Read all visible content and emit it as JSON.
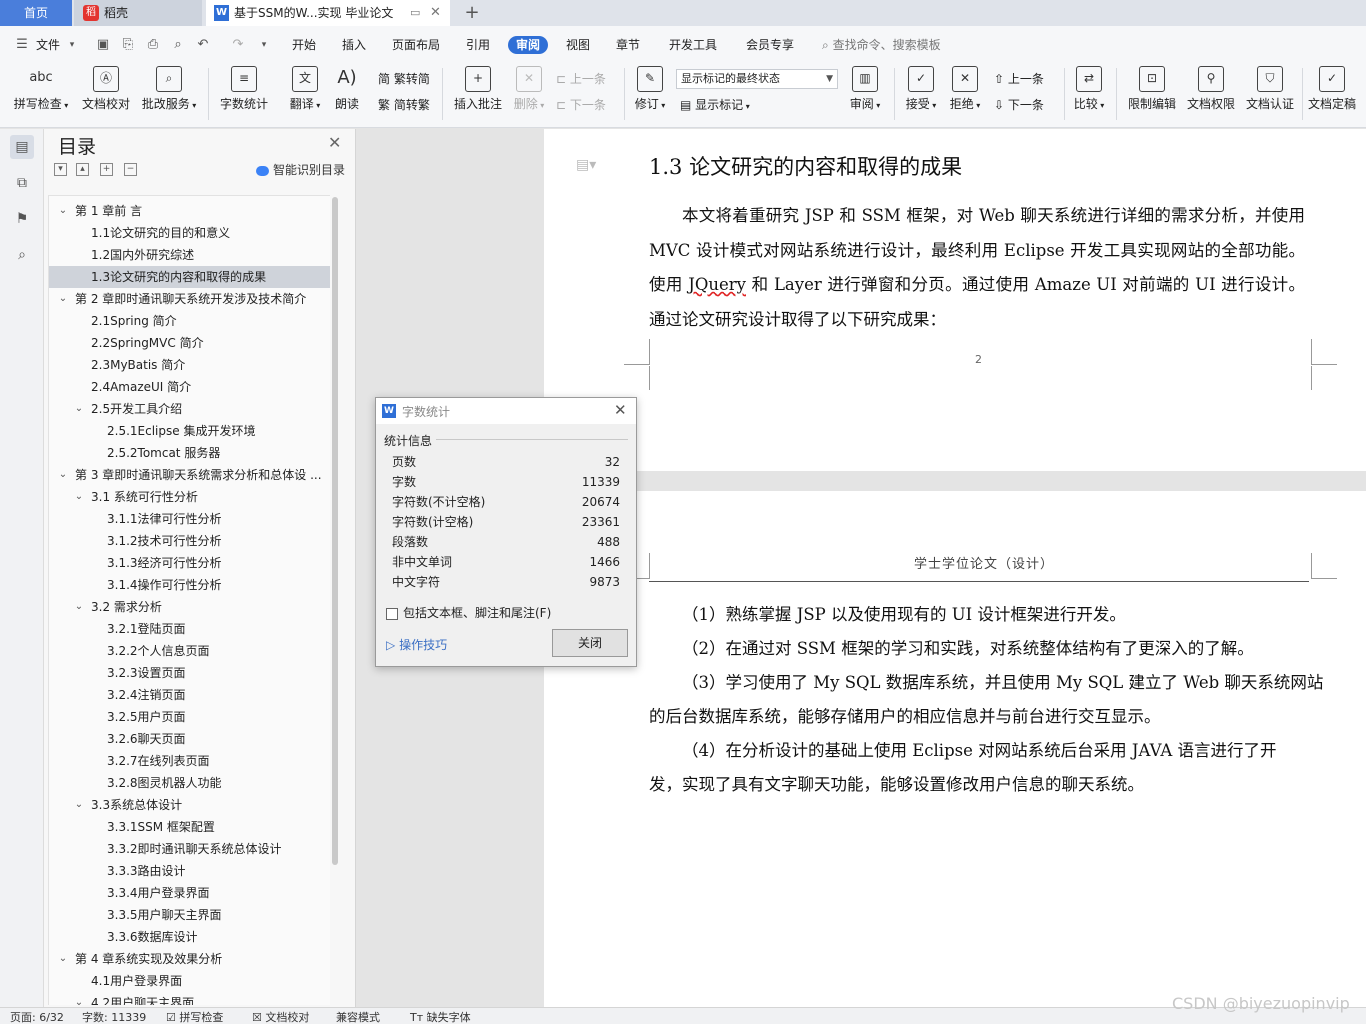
{
  "tabs": {
    "home": "首页",
    "dao": "稻壳",
    "doc": "基于SSM的W...实现 毕业论文",
    "add": "+"
  },
  "menu": {
    "file": "文件",
    "items": [
      "开始",
      "插入",
      "页面布局",
      "引用",
      "审阅",
      "视图",
      "章节",
      "开发工具",
      "会员专享"
    ],
    "active_index": 4,
    "search": "查找命令、搜索模板"
  },
  "ribbon": {
    "spell": "拼写检查",
    "proof": "文档校对",
    "batch": "批改服务",
    "wordcount": "字数统计",
    "translate": "翻译",
    "read": "朗读",
    "trad": "繁转简",
    "simp": "简转繁",
    "insert_comment": "插入批注",
    "delete": "删除",
    "prev_comment": "上一条",
    "next_comment": "下一条",
    "track": "修订",
    "markup_state": "显示标记的最终状态",
    "show_markup": "显示标记",
    "review": "审阅",
    "accept": "接受",
    "reject": "拒绝",
    "prev": "上一条",
    "next": "下一条",
    "compare": "比较",
    "restrict": "限制编辑",
    "permission": "文档权限",
    "certify": "文档认证",
    "finalize": "文档定稿"
  },
  "toc": {
    "title": "目录",
    "smart": "智能识别目录",
    "items": [
      {
        "text": "第 1 章前  言",
        "level": 0,
        "expand": true
      },
      {
        "text": "1.1论文研究的目的和意义",
        "level": 1
      },
      {
        "text": "1.2国内外研究综述",
        "level": 1
      },
      {
        "text": "1.3论文研究的内容和取得的成果",
        "level": 1,
        "selected": true
      },
      {
        "text": "第 2 章即时通讯聊天系统开发涉及技术简介",
        "level": 0,
        "expand": true
      },
      {
        "text": "2.1Spring 简介",
        "level": 1
      },
      {
        "text": "2.2SpringMVC 简介",
        "level": 1
      },
      {
        "text": "2.3MyBatis 简介",
        "level": 1
      },
      {
        "text": "2.4AmazeUI 简介",
        "level": 1
      },
      {
        "text": "2.5开发工具介绍",
        "level": 1,
        "expand": true
      },
      {
        "text": "2.5.1Eclipse 集成开发环境",
        "level": 2
      },
      {
        "text": "2.5.2Tomcat 服务器",
        "level": 2
      },
      {
        "text": "第 3 章即时通讯聊天系统需求分析和总体设 ...",
        "level": 0,
        "expand": true
      },
      {
        "text": "3.1  系统可行性分析",
        "level": 1,
        "expand": true
      },
      {
        "text": "3.1.1法律可行性分析",
        "level": 2
      },
      {
        "text": "3.1.2技术可行性分析",
        "level": 2
      },
      {
        "text": "3.1.3经济可行性分析",
        "level": 2
      },
      {
        "text": "3.1.4操作可行性分析",
        "level": 2
      },
      {
        "text": "3.2  需求分析",
        "level": 1,
        "expand": true
      },
      {
        "text": "3.2.1登陆页面",
        "level": 2
      },
      {
        "text": "3.2.2个人信息页面",
        "level": 2
      },
      {
        "text": "3.2.3设置页面",
        "level": 2
      },
      {
        "text": "3.2.4注销页面",
        "level": 2
      },
      {
        "text": "3.2.5用户页面",
        "level": 2
      },
      {
        "text": "3.2.6聊天页面",
        "level": 2
      },
      {
        "text": "3.2.7在线列表页面",
        "level": 2
      },
      {
        "text": "3.2.8图灵机器人功能",
        "level": 2
      },
      {
        "text": "3.3系统总体设计",
        "level": 1,
        "expand": true
      },
      {
        "text": "3.3.1SSM 框架配置",
        "level": 2
      },
      {
        "text": "3.3.2即时通讯聊天系统总体设计",
        "level": 2
      },
      {
        "text": "3.3.3路由设计",
        "level": 2
      },
      {
        "text": "3.3.4用户登录界面",
        "level": 2
      },
      {
        "text": "3.3.5用户聊天主界面",
        "level": 2
      },
      {
        "text": "3.3.6数据库设计",
        "level": 2
      },
      {
        "text": "第 4 章系统实现及效果分析",
        "level": 0,
        "expand": true
      },
      {
        "text": "4.1用户登录界面",
        "level": 1
      },
      {
        "text": "4.2用户聊天主界面",
        "level": 1,
        "expand": true
      }
    ]
  },
  "doc": {
    "heading": "1.3  论文研究的内容和取得的成果",
    "para1_a": "本文将着重研究 JSP 和 SSM 框架，对 Web 聊天系统进行详细的需求分析，并使用 MVC 设计模式对网站系统进行设计，最终利用 Eclipse  开发工具实现网站的全部功能。使用 ",
    "para1_sq": "JQuery",
    "para1_b": " 和 Layer 进行弹窗和分页。通过使用 Amaze UI 对前端的 UI 进行设计。通过论文研究设计取得了以下研究成果：",
    "page_number": "2",
    "header": "学士学位论文（设计）",
    "lines": [
      "（1）熟练掌握 JSP 以及使用现有的 UI 设计框架进行开发。",
      "（2）在通过对 SSM 框架的学习和实践，对系统整体结构有了更深入的了解。",
      "（3）学习使用了 My SQL 数据库系统，并且使用 My SQL 建立了 Web 聊天系统网站",
      "的后台数据库系统，能够存储用户的相应信息并与前台进行交互显示。",
      "（4）在分析设计的基础上使用 Eclipse 对网站系统后台采用 JAVA 语言进行了开",
      "发，实现了具有文字聊天功能，能够设置修改用户信息的聊天系统。"
    ]
  },
  "dialog": {
    "title": "字数统计",
    "group": "统计信息",
    "rows": [
      {
        "label": "页数",
        "value": "32"
      },
      {
        "label": "字数",
        "value": "11339"
      },
      {
        "label": "字符数(不计空格)",
        "value": "20674"
      },
      {
        "label": "字符数(计空格)",
        "value": "23361"
      },
      {
        "label": "段落数",
        "value": "488"
      },
      {
        "label": "非中文单词",
        "value": "1466"
      },
      {
        "label": "中文字符",
        "value": "9873"
      }
    ],
    "include_label": "包括文本框、脚注和尾注(F)",
    "tips": "操作技巧",
    "close": "关闭"
  },
  "status": {
    "page": "页面: 6/32",
    "words": "字数: 11339",
    "spell": "拼写检查",
    "proof": "文档校对",
    "compat": "兼容模式",
    "font": "缺失字体"
  },
  "watermark": "CSDN @biyezuopinvip",
  "colors": {
    "accent": "#2f6fd6",
    "tab_home": "#4a7edb",
    "dao_logo": "#e3342f"
  }
}
